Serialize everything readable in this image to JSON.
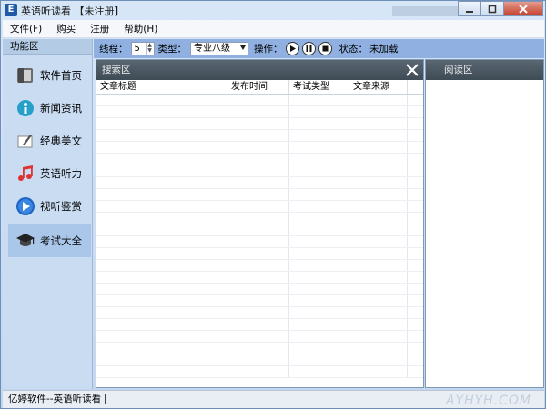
{
  "window": {
    "title": "英语听读看 【未注册】",
    "app_icon_glyph": "E"
  },
  "menu": [
    "文件(F)",
    "购买",
    "注册",
    "帮助(H)"
  ],
  "left_panel": {
    "title": "功能区",
    "items": [
      {
        "label": "软件首页",
        "icon": "home-icon"
      },
      {
        "label": "新闻资讯",
        "icon": "news-icon"
      },
      {
        "label": "经典美文",
        "icon": "pen-icon"
      },
      {
        "label": "英语听力",
        "icon": "music-note-icon"
      },
      {
        "label": "视听鉴赏",
        "icon": "play-icon"
      },
      {
        "label": "考试大全",
        "icon": "graduation-cap-icon",
        "active": true
      }
    ]
  },
  "toolbar": {
    "threads_label": "线程：",
    "threads_value": "5",
    "type_label": "类型：",
    "type_value": "专业八级",
    "ops_label": "操作：",
    "status_label": "状态：",
    "status_value": "未加载"
  },
  "search_area": {
    "title": "搜索区",
    "columns": [
      "文章标题",
      "发布时间",
      "考试类型",
      "文章来源"
    ]
  },
  "read_area": {
    "title": "阅读区"
  },
  "statusbar": {
    "text": "亿婷软件--英语听读看",
    "watermark": "AYHYH.COM"
  },
  "colors": {
    "panel_header": "#3e4b55",
    "toolbar_bg": "#8fb0e0",
    "active_nav": "#aac7ea"
  }
}
